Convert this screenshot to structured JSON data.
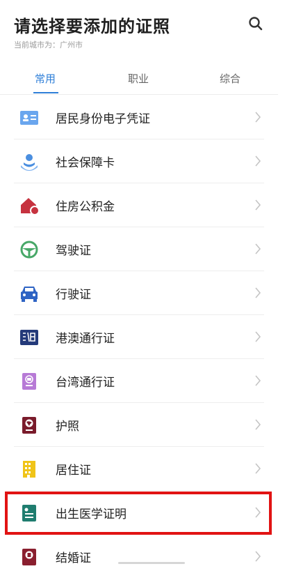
{
  "header": {
    "title": "请选择要添加的证照",
    "city_text": "当前城市为：广州市",
    "search_icon": "search-icon"
  },
  "tabs": [
    {
      "label": "常用",
      "active": true
    },
    {
      "label": "职业",
      "active": false
    },
    {
      "label": "综合",
      "active": false
    }
  ],
  "items": [
    {
      "label": "居民身份电子凭证",
      "icon": "id-card-icon",
      "color": "#6aa6ee"
    },
    {
      "label": "社会保障卡",
      "icon": "hand-person-icon",
      "color": "#4b8fe0"
    },
    {
      "label": "住房公积金",
      "icon": "house-icon",
      "color": "#c6323f"
    },
    {
      "label": "驾驶证",
      "icon": "steering-wheel-icon",
      "color": "#48a868"
    },
    {
      "label": "行驶证",
      "icon": "car-icon",
      "color": "#2f64c4"
    },
    {
      "label": "港澳通行证",
      "icon": "hk-macau-badge-icon",
      "color": "#243a7a"
    },
    {
      "label": "台湾通行证",
      "icon": "taiwan-pass-icon",
      "color": "#b77ad6"
    },
    {
      "label": "护照",
      "icon": "passport-icon",
      "color": "#7a1b2b"
    },
    {
      "label": "居住证",
      "icon": "building-icon",
      "color": "#f0c419"
    },
    {
      "label": "出生医学证明",
      "icon": "certificate-icon",
      "color": "#1f7d6f"
    },
    {
      "label": "结婚证",
      "icon": "marriage-cert-icon",
      "color": "#8a1f2f"
    }
  ],
  "highlight": {
    "target": "出生医学证明",
    "color": "#e11313"
  }
}
